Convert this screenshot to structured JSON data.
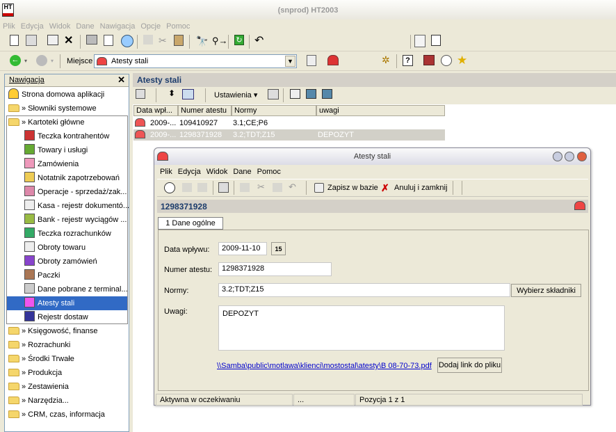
{
  "app": {
    "title": "(snprod)  HT2003",
    "logo": "HT"
  },
  "menu": [
    "Plik",
    "Edycja",
    "Widok",
    "Dane",
    "Nawigacja",
    "Opcje",
    "Pomoc"
  ],
  "address": {
    "label": "Miejsce",
    "value": "Atesty stali"
  },
  "nav": {
    "title": "Nawigacja",
    "items": [
      {
        "label": "Strona domowa aplikacji",
        "type": "home"
      },
      {
        "label": "» Słowniki systemowe",
        "type": "folder"
      },
      {
        "label": "» Kartoteki główne",
        "type": "folder"
      },
      {
        "label": "Teczka kontrahentów",
        "type": "sub"
      },
      {
        "label": "Towary i usługi",
        "type": "sub"
      },
      {
        "label": "Zamówienia",
        "type": "sub"
      },
      {
        "label": "Notatnik zapotrzebowań",
        "type": "sub"
      },
      {
        "label": "Operacje - sprzedaż/zak...",
        "type": "sub"
      },
      {
        "label": "Kasa - rejestr dokumentó...",
        "type": "sub"
      },
      {
        "label": "Bank - rejestr wyciągów ...",
        "type": "sub"
      },
      {
        "label": "Teczka rozrachunków",
        "type": "sub"
      },
      {
        "label": "Obroty towaru",
        "type": "sub"
      },
      {
        "label": "Obroty zamówień",
        "type": "sub"
      },
      {
        "label": "Paczki",
        "type": "sub"
      },
      {
        "label": "Dane pobrane z terminal...",
        "type": "sub"
      },
      {
        "label": "Atesty stali",
        "type": "sub-selected"
      },
      {
        "label": "Rejestr dostaw",
        "type": "sub"
      },
      {
        "label": "» Księgowość, finanse",
        "type": "folder"
      },
      {
        "label": "» Rozrachunki",
        "type": "folder"
      },
      {
        "label": "» Środki Trwałe",
        "type": "folder"
      },
      {
        "label": "» Produkcja",
        "type": "folder"
      },
      {
        "label": "» Zestawienia",
        "type": "folder"
      },
      {
        "label": "» Narzędzia...",
        "type": "folder"
      },
      {
        "label": "» CRM, czas, informacja",
        "type": "folder"
      }
    ]
  },
  "main": {
    "title": "Atesty stali",
    "settings_label": "Ustawienia",
    "grid": {
      "columns": [
        "Data wpł...",
        "Numer atestu",
        "Normy",
        "uwagi"
      ],
      "rows": [
        [
          "2009-...",
          "109410927",
          "3.1;CE;P6",
          ""
        ],
        [
          "2009-...",
          "1298371928",
          "3.2;TDT;Z15",
          "DEPOZYT"
        ]
      ]
    }
  },
  "dialog": {
    "title": "Atesty stali",
    "menu": [
      "Plik",
      "Edycja",
      "Widok",
      "Dane",
      "Pomoc"
    ],
    "save_label": "Zapisz w bazie",
    "cancel_label": "Anuluj i zamknij",
    "record_id": "1298371928",
    "tab": "1 Dane ogólne",
    "fields": {
      "date_label": "Data wpływu:",
      "date_value": "2009-11-10",
      "date_btn": "15",
      "number_label": "Numer atestu:",
      "number_value": "1298371928",
      "norms_label": "Normy:",
      "norms_value": "3.2;TDT;Z15",
      "norms_btn": "Wybierz składniki",
      "notes_label": "Uwagi:",
      "notes_value": "DEPOZYT",
      "link": "\\\\Samba\\public\\motlawa\\klienci\\mostostal\\atesty\\B 08-70-73.pdf",
      "link_btn": "Dodaj link do pliku"
    },
    "status": {
      "state": "Aktywna w oczekiwaniu",
      "dots": "...",
      "position": "Pozycja 1 z 1"
    }
  }
}
